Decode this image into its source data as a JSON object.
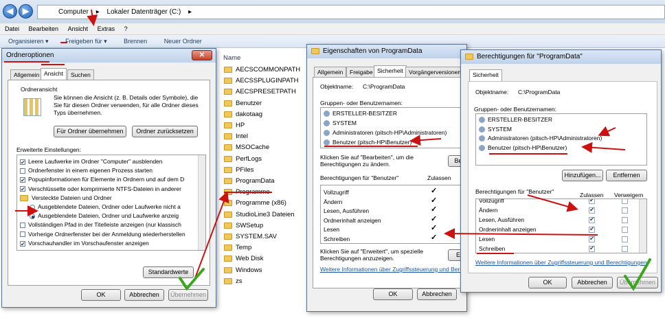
{
  "explorer": {
    "breadcrumb": [
      "Computer",
      "Lokaler Datenträger (C:)"
    ],
    "menu": [
      "Datei",
      "Bearbeiten",
      "Ansicht",
      "Extras",
      "?"
    ],
    "toolbar": [
      "Organisieren ▾",
      "Freigeben für ▾",
      "Brennen",
      "Neuer Ordner"
    ],
    "column_header": "Name",
    "files": [
      "AECSCOMMONPATH",
      "AECSSPLUGINPATH",
      "AECSPRESETPATH",
      "Benutzer",
      "dakotaag",
      "HP",
      "Intel",
      "MSOCache",
      "PerfLogs",
      "PFiles",
      "ProgramData",
      "Programme",
      "Programme (x86)",
      "StudioLine3 Dateien",
      "SWSetup",
      "SYSTEM.SAV",
      "Temp",
      "Web Disk",
      "Windows",
      "zs"
    ]
  },
  "folder_options": {
    "title": "Ordneroptionen",
    "tabs": [
      "Allgemein",
      "Ansicht",
      "Suchen"
    ],
    "group_title": "Ordneransicht",
    "group_text": "Sie können die Ansicht (z. B. Details oder Symbole), die Sie für diesen Ordner verwenden, für alle Ordner dieses Typs übernehmen.",
    "btn_apply": "Für Ordner übernehmen",
    "btn_reset": "Ordner zurücksetzen",
    "advanced_label": "Erweiterte Einstellungen:",
    "settings": [
      {
        "type": "check",
        "on": true,
        "text": "Leere Laufwerke im Ordner \"Computer\" ausblenden"
      },
      {
        "type": "check",
        "on": false,
        "text": "Ordnerfenster in einem eigenen Prozess starten"
      },
      {
        "type": "check",
        "on": true,
        "text": "Popupinformationen für Elemente in Ordnern und auf dem D"
      },
      {
        "type": "check",
        "on": true,
        "text": "Verschlüsselte oder komprimierte NTFS-Dateien in anderer"
      },
      {
        "type": "folder",
        "on": false,
        "text": "Versteckte Dateien und Ordner"
      },
      {
        "type": "radio",
        "on": false,
        "text": "Ausgeblendete Dateien, Ordner oder Laufwerke nicht a"
      },
      {
        "type": "radio",
        "on": true,
        "text": "Ausgeblendete Dateien, Ordner und Laufwerke anzeig"
      },
      {
        "type": "check",
        "on": false,
        "text": "Vollständigen Pfad in der Titelleiste anzeigen (nur klassisch"
      },
      {
        "type": "check",
        "on": false,
        "text": "Vorherige Ordnerfenster bei der Anmeldung wiederherstellen"
      },
      {
        "type": "check",
        "on": true,
        "text": "Vorschauhandler im Vorschaufenster anzeigen"
      }
    ],
    "btn_defaults": "Standardwerte",
    "btn_ok": "OK",
    "btn_cancel": "Abbrechen",
    "btn_apply_main": "Übernehmen"
  },
  "properties": {
    "title": "Eigenschaften von ProgramData",
    "tabs": [
      "Allgemein",
      "Freigabe",
      "Sicherheit",
      "Vorgängerversionen"
    ],
    "object_label": "Objektname:",
    "object_value": "C:\\ProgramData",
    "groups_label": "Gruppen- oder Benutzernamen:",
    "groups": [
      "ERSTELLER-BESITZER",
      "SYSTEM",
      "Administratoren (pitsch-HP\\Administratoren)",
      "Benutzer (pitsch-HP\\Benutzer)"
    ],
    "edit_text": "Klicken Sie auf \"Bearbeiten\", um die Berechtigungen zu ändern.",
    "edit_btn": "Be",
    "perms_label": "Berechtigungen für \"Benutzer\"",
    "allow_label": "Zulassen",
    "perms": [
      "Vollzugriff",
      "Ändern",
      "Lesen, Ausführen",
      "Ordnerinhalt anzeigen",
      "Lesen",
      "Schreiben"
    ],
    "perm_allow": [
      true,
      true,
      true,
      true,
      true,
      true
    ],
    "advanced_text": "Klicken Sie auf \"Erweitert\", um spezielle Berechtigungen anzuzeigen.",
    "advanced_btn": "E",
    "link": "Weitere Informationen über Zugriffssteuerung und Berech",
    "btn_ok": "OK",
    "btn_cancel": "Abbrechen"
  },
  "permissions": {
    "title": "Berechtigungen für \"ProgramData\"",
    "tab": "Sicherheit",
    "object_label": "Objektname:",
    "object_value": "C:\\ProgramData",
    "groups_label": "Gruppen- oder Benutzernamen:",
    "groups": [
      "ERSTELLER-BESITZER",
      "SYSTEM",
      "Administratoren (pitsch-HP\\Administratoren)",
      "Benutzer (pitsch-HP\\Benutzer)"
    ],
    "btn_add": "Hinzufügen...",
    "btn_remove": "Entfernen",
    "perms_label": "Berechtigungen für \"Benutzer\"",
    "allow_label": "Zulassen",
    "deny_label": "Verweigern",
    "perms": [
      "Vollzugriff",
      "Ändern",
      "Lesen, Ausführen",
      "Ordnerinhalt anzeigen",
      "Lesen",
      "Schreiben"
    ],
    "perm_allow": [
      true,
      true,
      true,
      true,
      true,
      true
    ],
    "perm_deny": [
      false,
      false,
      false,
      false,
      false,
      false
    ],
    "link": "Weitere Informationen über Zugriffssteuerung und Berechtigungen",
    "btn_ok": "OK",
    "btn_cancel": "Abbrechen",
    "btn_apply": "Übernehmen"
  },
  "colors": {
    "annotation": "#cc1111",
    "checkmark": "#3aa61e"
  }
}
